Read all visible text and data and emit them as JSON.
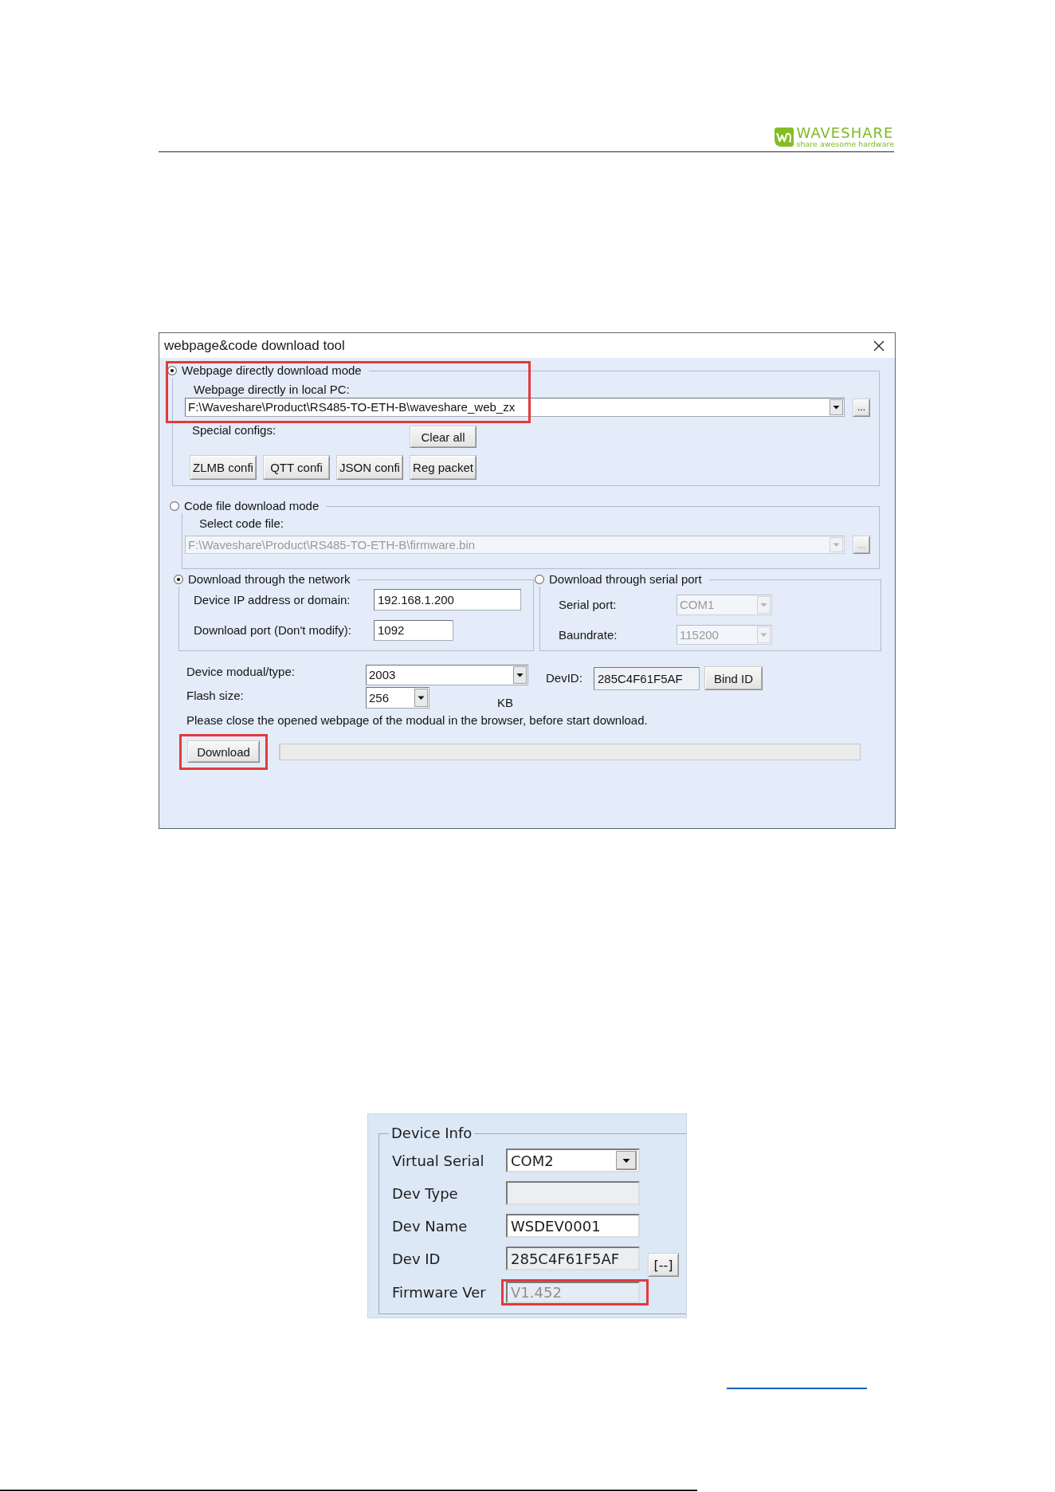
{
  "header": {
    "brand": "WAVESHARE",
    "tagline": "share awesome hardware"
  },
  "dialog": {
    "title": "webpage&code download tool",
    "modes": [
      {
        "kind": "webpage",
        "label": "Webpage directly download mode",
        "selected": true,
        "highlighted": true,
        "file_label": "Webpage directly in local PC:",
        "path": "F:\\Waveshare\\Product\\RS485-TO-ETH-B\\waveshare_web_zx",
        "disabled": false,
        "browse": "...",
        "configs_label": "Special configs:",
        "clear_button": "Clear all",
        "config_buttons": [
          "ZLMB confi",
          "QTT confi",
          "JSON confi",
          "Reg packet"
        ]
      },
      {
        "kind": "code",
        "label": "Code file download mode",
        "selected": false,
        "highlighted": false,
        "file_label": "Select code file:",
        "path": "F:\\Waveshare\\Product\\RS485-TO-ETH-B\\firmware.bin",
        "disabled": true,
        "browse": "..."
      }
    ],
    "transports": [
      {
        "kind": "network",
        "label": "Download through the network",
        "selected": true,
        "fields": [
          {
            "kind": "text",
            "label": "Device IP address or domain:",
            "value": "192.168.1.200",
            "disabled": false
          },
          {
            "kind": "text",
            "label": "Download port (Don't modify):",
            "value": "1092",
            "disabled": false
          }
        ]
      },
      {
        "kind": "serial",
        "label": "Download through serial port",
        "selected": false,
        "fields": [
          {
            "kind": "combo",
            "label": "Serial port:",
            "value": "COM1",
            "disabled": true
          },
          {
            "kind": "combo",
            "label": "Baundrate:",
            "value": "115200",
            "disabled": true
          }
        ]
      }
    ],
    "device": {
      "type_label": "Device modual/type:",
      "type_value": "2003",
      "devid_label": "DevID:",
      "devid_value": "285C4F61F5AF",
      "devid_readonly": true,
      "bind_button": "Bind ID",
      "flash_label": "Flash size:",
      "flash_value": "256",
      "flash_unit": "KB"
    },
    "notice": "Please close the opened webpage of the modual in the browser, before start download.",
    "download": {
      "button": "Download",
      "highlighted": true,
      "level": 0
    }
  },
  "device_info": {
    "title": "Device Info",
    "rows": [
      {
        "kind": "combo",
        "label": "Virtual Serial",
        "value": "COM2",
        "readonly": false,
        "disabled": false,
        "highlighted": false
      },
      {
        "kind": "text",
        "label": "Dev Type",
        "readonly": true,
        "disabled": false,
        "highlighted": false
      },
      {
        "kind": "text",
        "label": "Dev Name",
        "value": "WSDEV0001",
        "readonly": false,
        "disabled": false,
        "highlighted": false
      },
      {
        "kind": "text",
        "label": "Dev ID",
        "value": "285C4F61F5AF",
        "readonly": true,
        "disabled": false,
        "highlighted": false,
        "button": "[--]"
      },
      {
        "kind": "text",
        "label": "Firmware Ver",
        "value": "V1.452",
        "readonly": false,
        "disabled": true,
        "highlighted": true
      }
    ]
  }
}
